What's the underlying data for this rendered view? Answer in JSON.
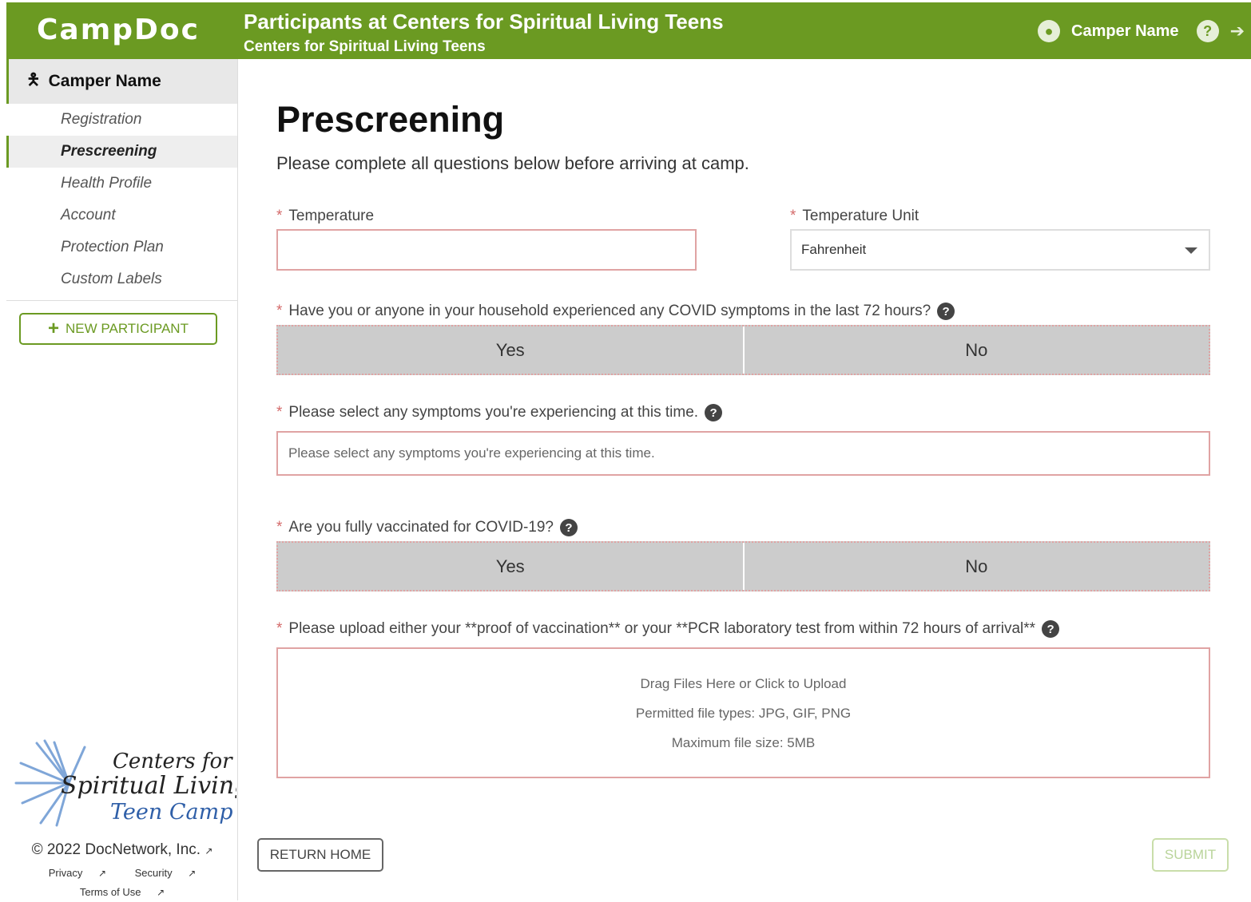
{
  "header": {
    "logo": "CampDoc",
    "title": "Participants at Centers for Spiritual Living Teens",
    "subtitle": "Centers for Spiritual Living Teens",
    "user_name": "Camper Name"
  },
  "sidebar": {
    "participant": "Camper Name",
    "items": [
      {
        "label": "Registration"
      },
      {
        "label": "Prescreening"
      },
      {
        "label": "Health Profile"
      },
      {
        "label": "Account"
      },
      {
        "label": "Protection Plan"
      },
      {
        "label": "Custom Labels"
      }
    ],
    "active_item": "Prescreening",
    "new_participant_label": "NEW PARTICIPANT",
    "brand": {
      "line1": "Centers for",
      "line2": "Spiritual Living",
      "line3": "Teen Camp",
      "tm": "™"
    },
    "copyright": "© 2022 DocNetwork, Inc.",
    "links": [
      "Privacy",
      "Security",
      "Terms of Use"
    ]
  },
  "page": {
    "title": "Prescreening",
    "intro": "Please complete all questions below before arriving at camp."
  },
  "form": {
    "temperature": {
      "label": "Temperature",
      "value": ""
    },
    "temperature_unit": {
      "label": "Temperature Unit",
      "value": "Fahrenheit"
    },
    "covid_symptoms": {
      "label": "Have you or anyone in your household experienced any COVID symptoms in the last 72 hours?",
      "yes": "Yes",
      "no": "No"
    },
    "symptoms": {
      "label": "Please select any symptoms you're experiencing at this time.",
      "placeholder": "Please select any symptoms you're experiencing at this time."
    },
    "vaccinated": {
      "label": "Are you fully vaccinated for COVID-19?",
      "yes": "Yes",
      "no": "No"
    },
    "upload": {
      "label": "Please upload either your **proof of vaccination** or your **PCR laboratory test from within 72 hours of arrival**",
      "line1": "Drag Files Here or Click to Upload",
      "line2": "Permitted file types: JPG, GIF, PNG",
      "line3": "Maximum file size: 5MB"
    }
  },
  "actions": {
    "return_home": "RETURN HOME",
    "submit": "SUBMIT"
  },
  "colors": {
    "brand_green": "#6b9a22",
    "required_border": "#e0a3a3"
  }
}
